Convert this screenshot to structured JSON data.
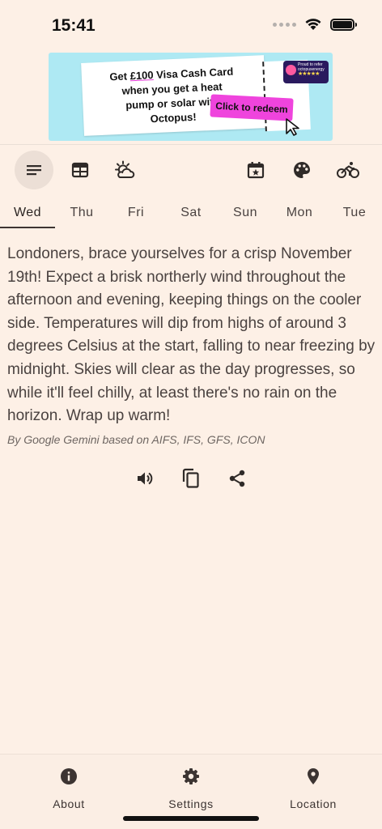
{
  "status_bar": {
    "time": "15:41"
  },
  "ad": {
    "line1_prefix": "Get ",
    "line1_amount": "£100",
    "line1_suffix": " Visa Cash Card",
    "line2": "when you get a heat",
    "line3": "pump or solar with",
    "line4": "Octopus!",
    "cta_label": "Click to redeem",
    "badge_line1": "Proud to refer",
    "badge_line2": "octopusenergy",
    "badge_stars": "★★★★★",
    "colors": {
      "background": "#aee9f3",
      "cta": "#ef44dd",
      "badge": "#2a1a5e"
    }
  },
  "toolbar": {
    "left": [
      {
        "icon": "text-summary-icon",
        "active": true
      },
      {
        "icon": "table-icon",
        "active": false
      },
      {
        "icon": "sun-cloud-icon",
        "active": false
      }
    ],
    "right": [
      {
        "icon": "calendar-star-icon"
      },
      {
        "icon": "palette-icon"
      },
      {
        "icon": "bicycle-icon"
      }
    ]
  },
  "day_tabs": [
    "Wed",
    "Thu",
    "Fri",
    "Sat",
    "Sun",
    "Mon",
    "Tue"
  ],
  "selected_day": "Wed",
  "forecast": {
    "text": "Londoners, brace yourselves for a crisp November 19th! Expect a brisk northerly wind throughout the afternoon and evening, keeping things on the cooler side. Temperatures will dip from highs of around 3 degrees Celsius at the start, falling to near freezing by midnight. Skies will clear as the day progresses, so while it'll feel chilly, at least there's no rain on the horizon. Wrap up warm!",
    "attribution": "By Google Gemini based on AIFS, IFS, GFS, ICON"
  },
  "actions": [
    {
      "icon": "speaker-icon"
    },
    {
      "icon": "copy-icon"
    },
    {
      "icon": "share-icon"
    }
  ],
  "bottom_nav": {
    "about": "About",
    "settings": "Settings",
    "location": "Location"
  }
}
